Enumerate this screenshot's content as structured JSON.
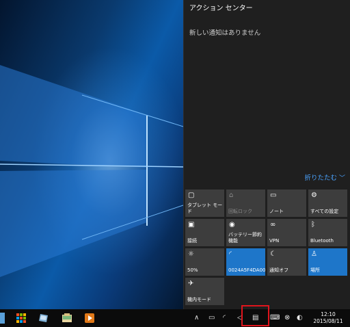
{
  "action_center": {
    "title": "アクション センター",
    "empty_message": "新しい通知はありません",
    "collapse_label": "折りたたむ",
    "tiles": [
      {
        "label": "タブレット モード",
        "icon": "tablet-mode-icon",
        "state": "off"
      },
      {
        "label": "回転ロック",
        "icon": "rotation-lock-icon",
        "state": "disabled"
      },
      {
        "label": "ノート",
        "icon": "note-icon",
        "state": "off"
      },
      {
        "label": "すべての設定",
        "icon": "gear-icon",
        "state": "off"
      },
      {
        "label": "接続",
        "icon": "connect-icon",
        "state": "off"
      },
      {
        "label": "バッテリー節約機能",
        "icon": "battery-saver-icon",
        "state": "off"
      },
      {
        "label": "VPN",
        "icon": "vpn-icon",
        "state": "off"
      },
      {
        "label": "Bluetooth",
        "icon": "bluetooth-icon",
        "state": "off"
      },
      {
        "label": "50%",
        "icon": "brightness-icon",
        "state": "off"
      },
      {
        "label": "0024A5F4DA00",
        "icon": "wifi-icon",
        "state": "on"
      },
      {
        "label": "通知オフ",
        "icon": "quiet-hours-icon",
        "state": "off"
      },
      {
        "label": "場所",
        "icon": "location-icon",
        "state": "on"
      },
      {
        "label": "機内モード",
        "icon": "airplane-mode-icon",
        "state": "off"
      }
    ]
  },
  "taskbar": {
    "clock_time": "12:10",
    "clock_date": "2015/08/11"
  },
  "colors": {
    "accent": "#1e76c9",
    "highlight": "#e1141c"
  }
}
